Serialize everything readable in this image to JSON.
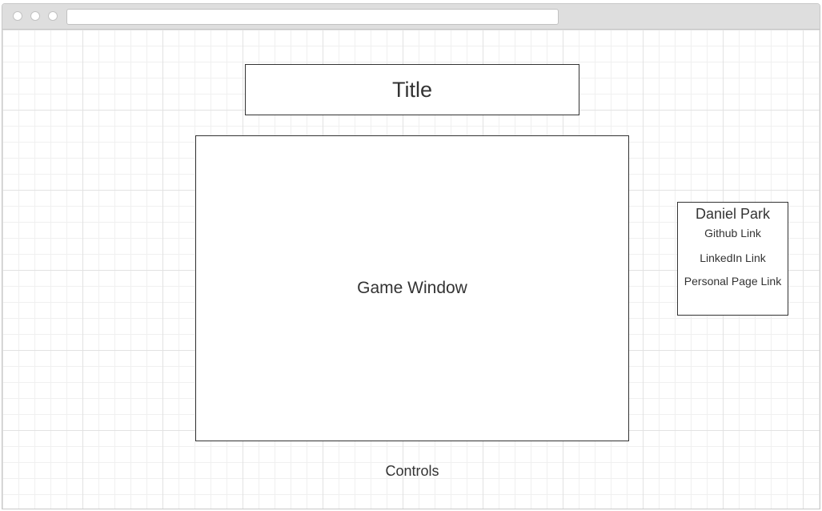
{
  "browser": {
    "address_value": ""
  },
  "page": {
    "title": "Title",
    "game_window_label": "Game Window",
    "controls_label": "Controls"
  },
  "profile": {
    "name": "Daniel Park",
    "links": [
      {
        "label": "Github Link"
      },
      {
        "label": "LinkedIn Link"
      },
      {
        "label": "Personal Page Link"
      }
    ]
  }
}
